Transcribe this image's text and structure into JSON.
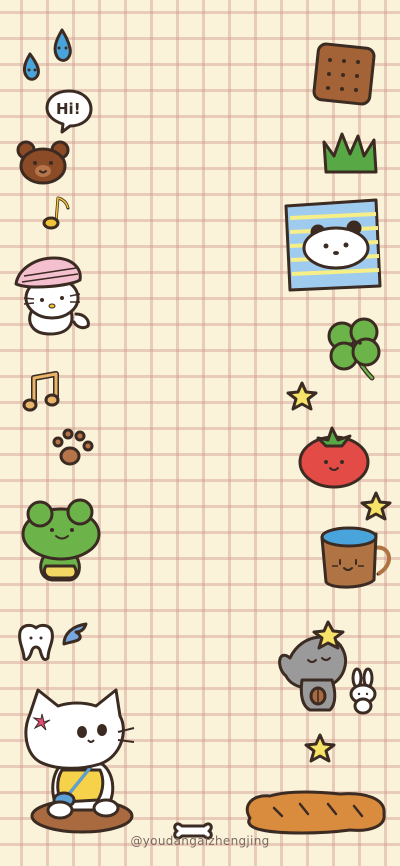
{
  "wallpaper": {
    "background_color": "#fbf3d9",
    "grid_color": "#cd968c",
    "speech_bubble_text": "Hi!",
    "watermark": "@youdangaizhengjing",
    "stickers": [
      "water-drop-icon",
      "speech-bubble-icon",
      "bear-face-icon",
      "music-note-icon",
      "pink-hat-kitty-icon",
      "double-music-note-icon",
      "paw-print-icon",
      "frog-icon",
      "tooth-icon",
      "blue-wings-icon",
      "white-cat-icon",
      "bone-icon",
      "biscuit-icon",
      "grass-icon",
      "panda-blanket-icon",
      "clover-icon",
      "star-icon",
      "tomato-icon",
      "coffee-mug-icon",
      "gray-elephant-icon",
      "bunny-icon",
      "bread-loaf-icon"
    ]
  }
}
